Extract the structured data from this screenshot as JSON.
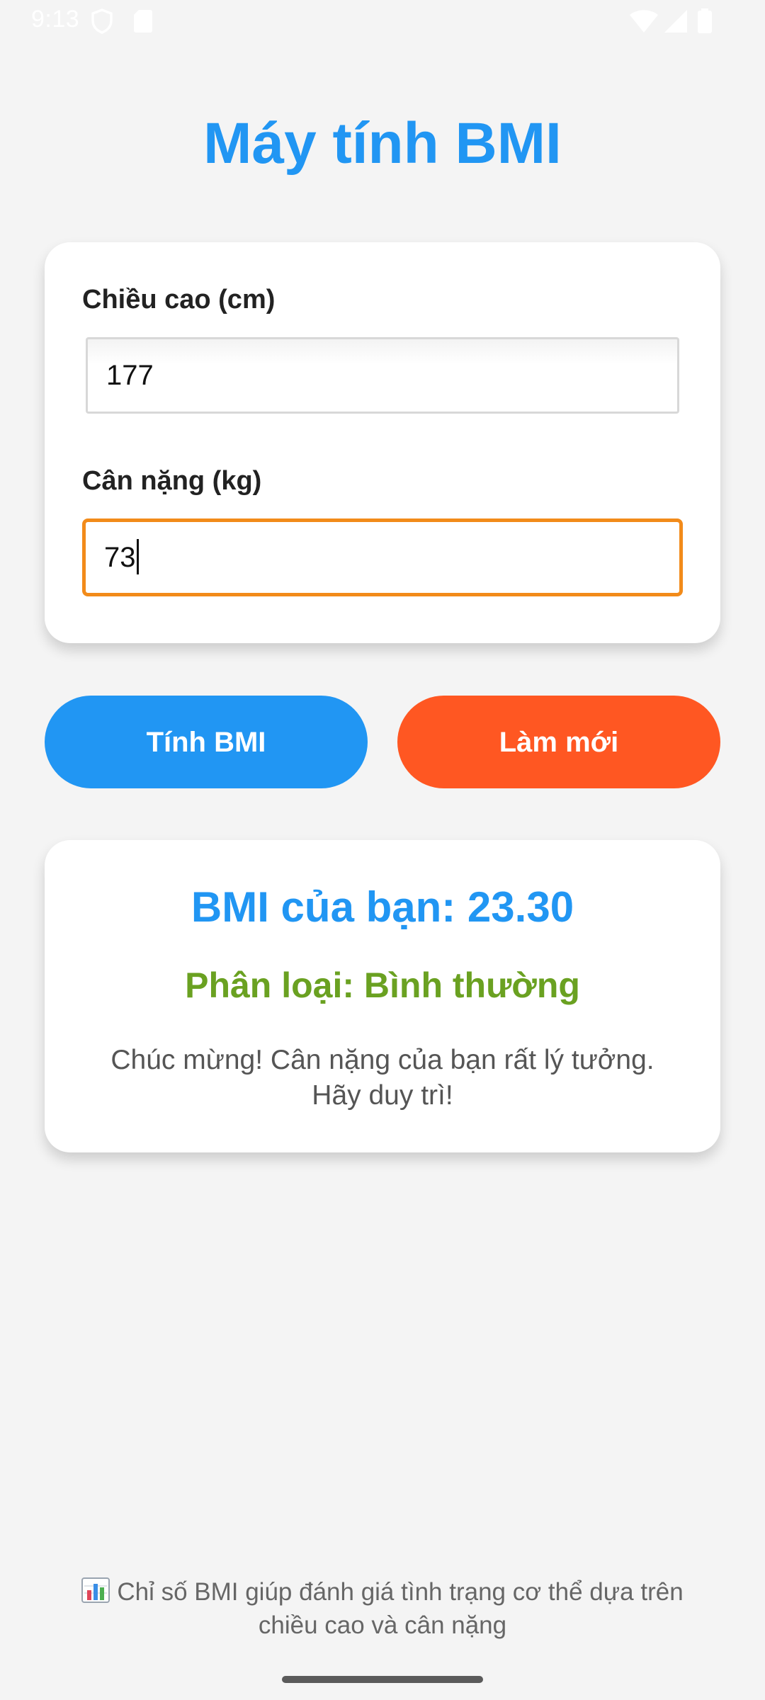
{
  "status_bar": {
    "time": "9:13",
    "icons": [
      "shield-icon",
      "sdcard-icon",
      "wifi-icon",
      "signal-icon",
      "battery-icon"
    ]
  },
  "app": {
    "title": "Máy tính BMI",
    "accent_color": "#2196f3"
  },
  "form": {
    "height_label": "Chiều cao (cm)",
    "height_value": "177",
    "weight_label": "Cân nặng (kg)",
    "weight_value": "73",
    "focus_color": "#f28b1a"
  },
  "buttons": {
    "calculate_label": "Tính BMI",
    "calculate_color": "#2196f3",
    "reset_label": "Làm mới",
    "reset_color": "#ff5722"
  },
  "result": {
    "bmi_text": "BMI của bạn: 23.30",
    "category_text": "Phân loại: Bình thường",
    "category_color": "#6aa121",
    "message": "Chúc mừng! Cân nặng của bạn rất lý tưởng. Hãy duy trì!"
  },
  "footer": {
    "icon": "bar-chart-icon",
    "note": "Chỉ số BMI giúp đánh giá tình trạng cơ thể dựa trên chiều cao và cân nặng"
  }
}
